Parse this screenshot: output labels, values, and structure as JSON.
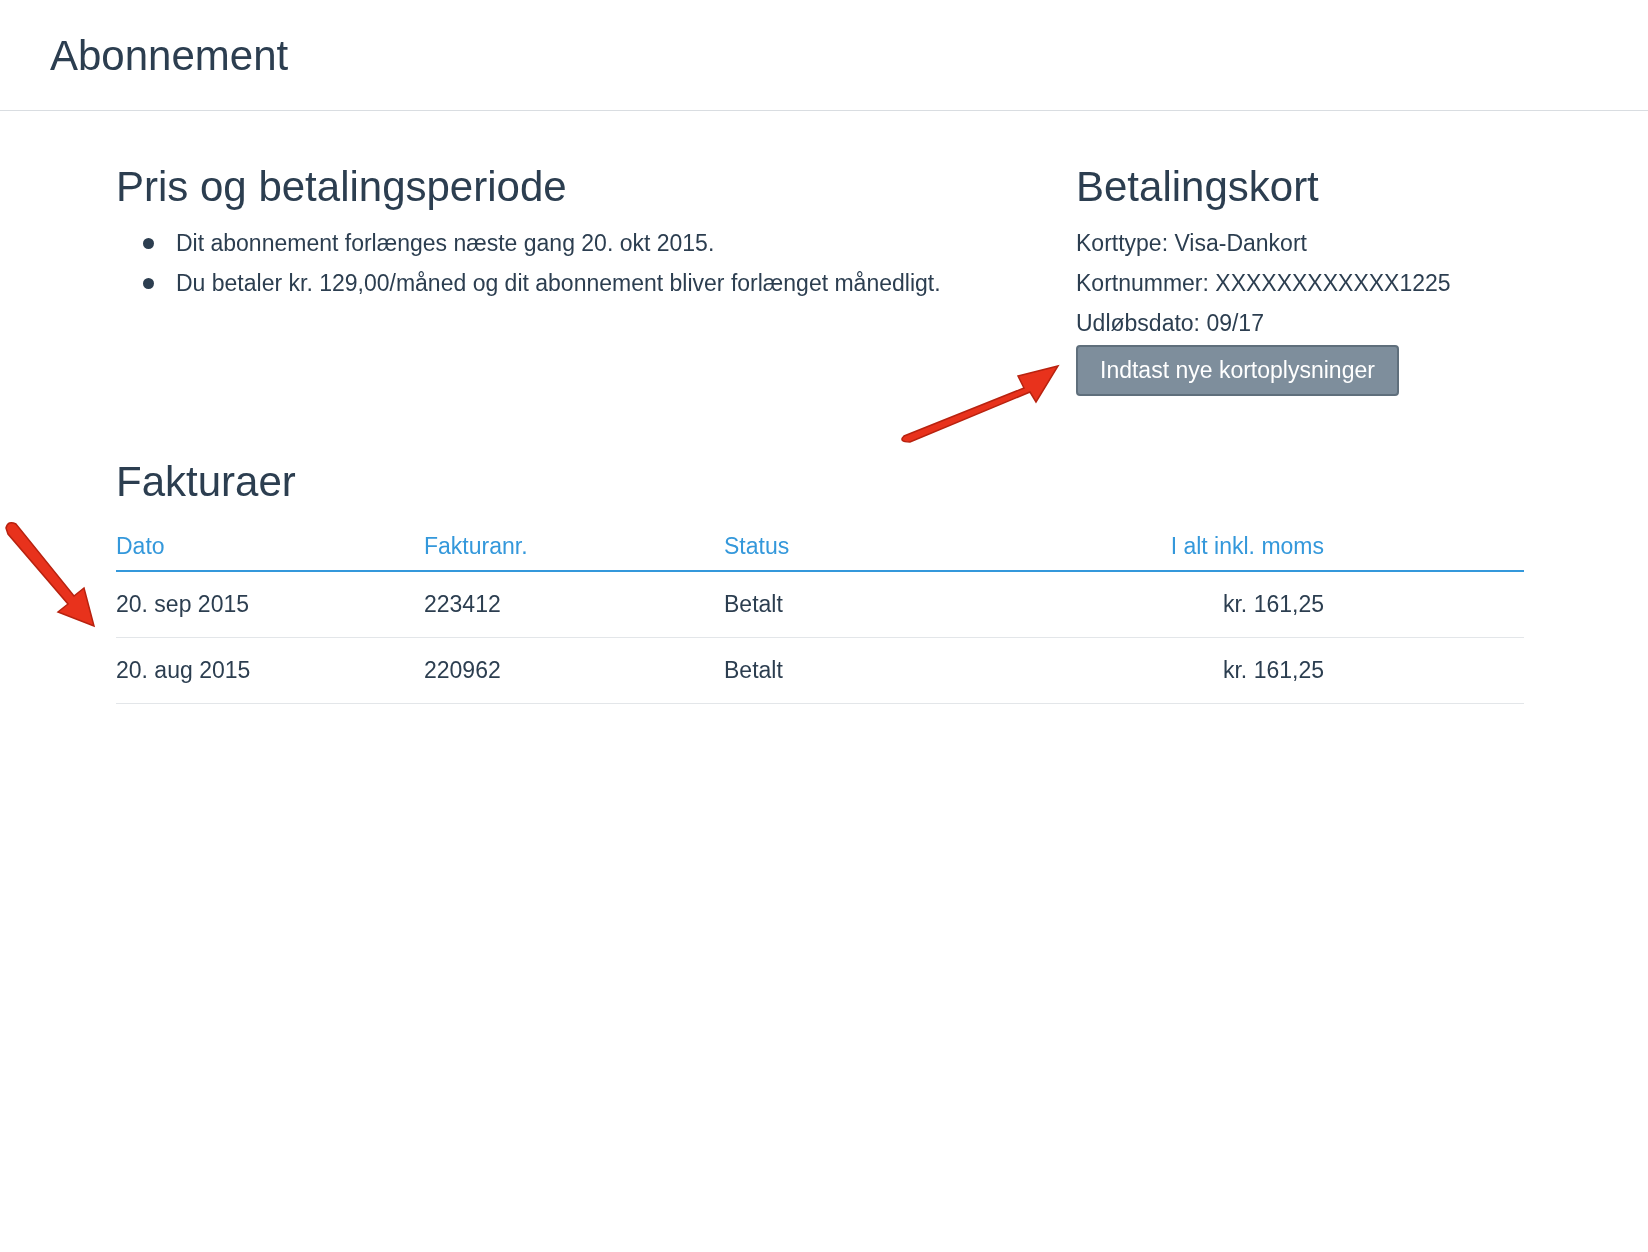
{
  "header": {
    "title": "Abonnement"
  },
  "price": {
    "title": "Pris og betalingsperiode",
    "bullets": [
      "Dit abonnement forlænges næste gang 20. okt 2015.",
      "Du betaler kr. 129,00/måned og dit abonnement bliver forlænget månedligt."
    ]
  },
  "card": {
    "title": "Betalingskort",
    "lines": [
      "Korttype: Visa-Dankort",
      "Kortnummer: XXXXXXXXXXXX1225",
      "Udløbsdato: 09/17"
    ],
    "button": "Indtast nye kortoplysninger"
  },
  "invoices": {
    "title": "Fakturaer",
    "columns": [
      "Dato",
      "Fakturanr.",
      "Status",
      "I alt inkl. moms"
    ],
    "rows": [
      [
        "20. sep 2015",
        "223412",
        "Betalt",
        "kr. 161,25"
      ],
      [
        "20. aug 2015",
        "220962",
        "Betalt",
        "kr. 161,25"
      ]
    ]
  }
}
